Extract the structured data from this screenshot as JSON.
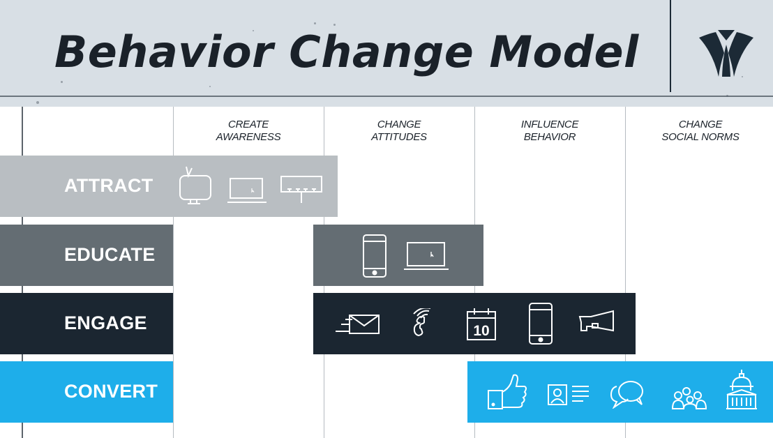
{
  "title": "Behavior Change Model",
  "logo": "brand-logo",
  "columns": [
    {
      "line1": "CREATE",
      "line2": "AWARENESS"
    },
    {
      "line1": "CHANGE",
      "line2": "ATTITUDES"
    },
    {
      "line1": "INFLUENCE",
      "line2": "BEHAVIOR"
    },
    {
      "line1": "CHANGE",
      "line2": "SOCIAL NORMS"
    }
  ],
  "rows": [
    {
      "label": "ATTRACT",
      "color": "#b9bec2",
      "stages": [
        "CREATE AWARENESS"
      ],
      "icons": [
        "tv-icon",
        "laptop-icon",
        "billboard-icon"
      ]
    },
    {
      "label": "EDUCATE",
      "color": "#646d73",
      "stages": [
        "CHANGE ATTITUDES"
      ],
      "icons": [
        "smartphone-icon",
        "laptop-icon"
      ]
    },
    {
      "label": "ENGAGE",
      "color": "#1b2631",
      "stages": [
        "CHANGE ATTITUDES",
        "INFLUENCE BEHAVIOR"
      ],
      "icons": [
        "email-icon",
        "phone-call-icon",
        "calendar-icon",
        "smartphone-icon",
        "megaphone-icon"
      ],
      "calendar_day": "10"
    },
    {
      "label": "CONVERT",
      "color": "#1eaeea",
      "stages": [
        "INFLUENCE BEHAVIOR",
        "CHANGE SOCIAL NORMS"
      ],
      "icons": [
        "thumbs-up-icon",
        "profile-card-icon",
        "chat-bubbles-icon",
        "community-icon",
        "capitol-building-icon"
      ]
    }
  ]
}
